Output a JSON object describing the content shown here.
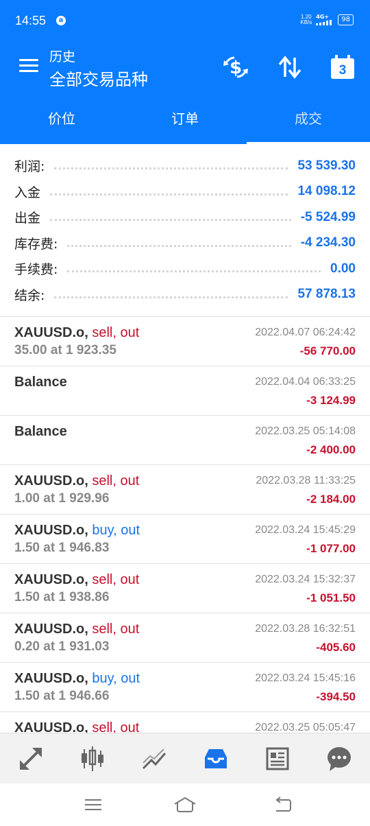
{
  "status_bar": {
    "time": "14:55",
    "notif_icon": "a",
    "net_speed_value": "1.20",
    "net_speed_unit": "KB/s",
    "network": "4G+",
    "battery": "98"
  },
  "header": {
    "subtitle": "历史",
    "title": "全部交易品种",
    "calendar_day": "3",
    "colors": {
      "primary": "#0a7cff",
      "profit_positive": "#1a73e8",
      "loss": "#c8102e"
    }
  },
  "tabs": [
    {
      "label": "价位",
      "active": false
    },
    {
      "label": "订单",
      "active": false
    },
    {
      "label": "成交",
      "active": true
    }
  ],
  "summary": [
    {
      "label": "利润:",
      "value": "53 539.30"
    },
    {
      "label": "入金",
      "value": "14 098.12"
    },
    {
      "label": "出金",
      "value": "-5 524.99"
    },
    {
      "label": "库存费:",
      "value": "-4 234.30"
    },
    {
      "label": "手续费:",
      "value": "0.00"
    },
    {
      "label": "结余:",
      "value": "57 878.13"
    }
  ],
  "deals": [
    {
      "symbol": "XAUUSD.o,",
      "side": "sell, out",
      "side_type": "sell",
      "volume": "35.00 at 1 923.35",
      "time": "2022.04.07 06:24:42",
      "profit": "-56 770.00"
    },
    {
      "symbol": "Balance",
      "side": "",
      "side_type": "",
      "volume": "",
      "time": "2022.04.04 06:33:25",
      "profit": "-3 124.99"
    },
    {
      "symbol": "Balance",
      "side": "",
      "side_type": "",
      "volume": "",
      "time": "2022.03.25 05:14:08",
      "profit": "-2 400.00"
    },
    {
      "symbol": "XAUUSD.o,",
      "side": "sell, out",
      "side_type": "sell",
      "volume": "1.00 at 1 929.96",
      "time": "2022.03.28 11:33:25",
      "profit": "-2 184.00"
    },
    {
      "symbol": "XAUUSD.o,",
      "side": "buy, out",
      "side_type": "buy",
      "volume": "1.50 at 1 946.83",
      "time": "2022.03.24 15:45:29",
      "profit": "-1 077.00"
    },
    {
      "symbol": "XAUUSD.o,",
      "side": "sell, out",
      "side_type": "sell",
      "volume": "1.50 at 1 938.86",
      "time": "2022.03.24 15:32:37",
      "profit": "-1 051.50"
    },
    {
      "symbol": "XAUUSD.o,",
      "side": "sell, out",
      "side_type": "sell",
      "volume": "0.20 at 1 931.03",
      "time": "2022.03.28 16:32:51",
      "profit": "-405.60"
    },
    {
      "symbol": "XAUUSD.o,",
      "side": "buy, out",
      "side_type": "buy",
      "volume": "1.50 at 1 946.66",
      "time": "2022.03.24 15:45:16",
      "profit": "-394.50"
    },
    {
      "symbol": "XAUUSD.o,",
      "side": "sell, out",
      "side_type": "sell",
      "volume": "",
      "time": "2022.03.25 05:05:47",
      "profit": ""
    }
  ],
  "bottom_nav": [
    {
      "icon": "quotes-arrows-icon",
      "active": false
    },
    {
      "icon": "candlestick-chart-icon",
      "active": false
    },
    {
      "icon": "trade-trend-icon",
      "active": false
    },
    {
      "icon": "history-inbox-icon",
      "active": true
    },
    {
      "icon": "news-icon",
      "active": false
    },
    {
      "icon": "chat-icon",
      "active": false
    }
  ]
}
